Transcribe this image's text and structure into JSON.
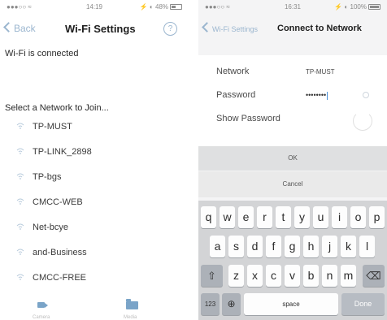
{
  "left_screen": {
    "status": {
      "signal": "●●●○○ ≈",
      "time": "14:19",
      "battery": "⚡ ◐ 48%"
    },
    "nav": {
      "back_label": "Back",
      "title": "Wi-Fi Settings",
      "help_label": "?"
    },
    "connected_text": "Wi-Fi is connected",
    "select_header": "Select a Network to Join...",
    "networks": [
      "TP-MUST",
      "TP-LINK_2898",
      "TP-bgs",
      "CMCC-WEB",
      "Net-bcye",
      "and-Business",
      "CMCC-FREE"
    ],
    "tabbar": {
      "tab1_label": "Camera",
      "tab2_label": "Media"
    }
  },
  "right_screen": {
    "status": {
      "signal": "●●●○○ ≈",
      "time": "16:31",
      "battery": "⚡ ◐ 100%"
    },
    "nav": {
      "back_label": "Wi-Fi Settings",
      "title": "Connect to Network"
    },
    "form": {
      "network_label": "Network",
      "network_value": "TP-MUST",
      "password_label": "Password",
      "password_value": "••••••••",
      "show_password_label": "Show Password"
    },
    "ok_label": "OK",
    "cancel_label": "Cancel",
    "keyboard": {
      "row1": [
        "q",
        "w",
        "e",
        "r",
        "t",
        "y",
        "u",
        "i",
        "o",
        "p"
      ],
      "row2": [
        "a",
        "s",
        "d",
        "f",
        "g",
        "h",
        "j",
        "k",
        "l"
      ],
      "row3": [
        "z",
        "x",
        "c",
        "v",
        "b",
        "n",
        "m"
      ],
      "shift_glyph": "⇧",
      "delete_glyph": "⌫",
      "numbers_label": "123",
      "globe_glyph": "⊕",
      "space_label": "space",
      "done_label": "Done"
    }
  },
  "colors": {
    "accent": "#9bb6cf",
    "tab_icon": "#7aa4c8",
    "keyboard_bg": "#d3d4d6",
    "key_bg": "#fdfdfd"
  }
}
